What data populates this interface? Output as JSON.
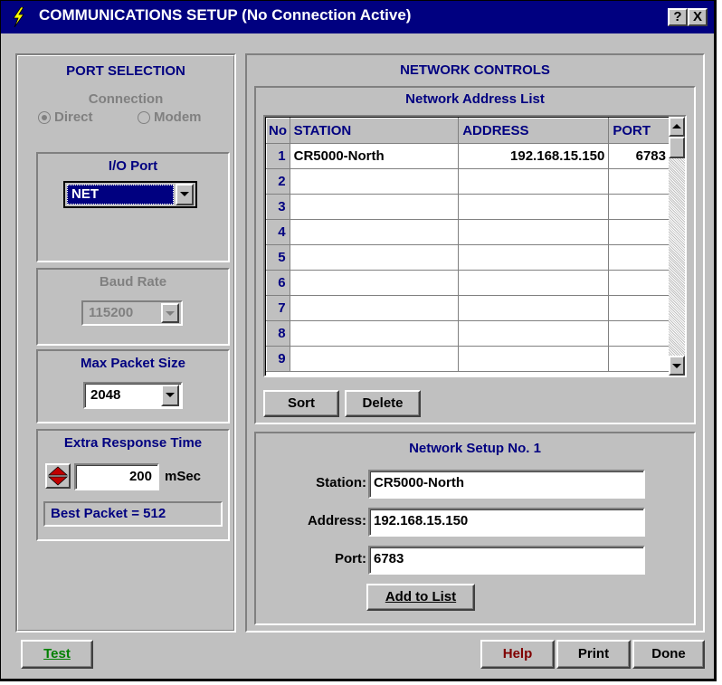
{
  "window": {
    "title": "COMMUNICATIONS SETUP  (No Connection Active)",
    "help_btn": "?",
    "close_btn": "X"
  },
  "port_selection": {
    "title": "PORT SELECTION",
    "connection_label": "Connection",
    "direct_label": "Direct",
    "modem_label": "Modem",
    "io_port_label": "I/O Port",
    "io_port_value": "NET",
    "baud_rate_label": "Baud Rate",
    "baud_rate_value": "115200",
    "max_packet_label": "Max Packet Size",
    "max_packet_value": "2048",
    "extra_response_label": "Extra Response Time",
    "extra_response_value": "200",
    "extra_response_unit": "mSec",
    "best_packet": "Best Packet = 512"
  },
  "network_controls": {
    "title": "NETWORK CONTROLS",
    "list_title": "Network Address List",
    "columns": [
      "No",
      "STATION",
      "ADDRESS",
      "PORT"
    ],
    "rows": [
      {
        "no": "1",
        "station": "CR5000-North",
        "address": "192.168.15.150",
        "port": "6783"
      },
      {
        "no": "2",
        "station": "",
        "address": "",
        "port": ""
      },
      {
        "no": "3",
        "station": "",
        "address": "",
        "port": ""
      },
      {
        "no": "4",
        "station": "",
        "address": "",
        "port": ""
      },
      {
        "no": "5",
        "station": "",
        "address": "",
        "port": ""
      },
      {
        "no": "6",
        "station": "",
        "address": "",
        "port": ""
      },
      {
        "no": "7",
        "station": "",
        "address": "",
        "port": ""
      },
      {
        "no": "8",
        "station": "",
        "address": "",
        "port": ""
      },
      {
        "no": "9",
        "station": "",
        "address": "",
        "port": ""
      }
    ],
    "sort_btn": "Sort",
    "delete_btn": "Delete"
  },
  "network_setup": {
    "title": "Network Setup No. 1",
    "station_label": "Station:",
    "station_value": "CR5000-North",
    "address_label": "Address:",
    "address_value": "192.168.15.150",
    "port_label": "Port:",
    "port_value": "6783",
    "add_btn": "Add to List"
  },
  "footer": {
    "test_btn": "Test",
    "help_btn": "Help",
    "print_btn": "Print",
    "done_btn": "Done"
  },
  "colors": {
    "titlebar": "#000080",
    "label": "#000080",
    "test": "#008000",
    "help": "#800000"
  }
}
